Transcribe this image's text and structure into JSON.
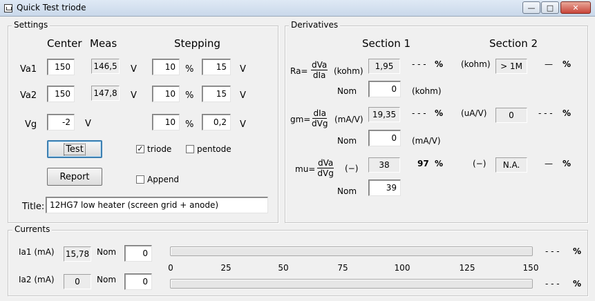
{
  "window": {
    "title": "Quick Test triode",
    "minimize": "—",
    "maximize": "□",
    "close": "✕"
  },
  "settings": {
    "group_label": "Settings",
    "col_center": "Center",
    "col_meas": "Meas",
    "col_stepping": "Stepping",
    "rows": [
      {
        "label": "Va1",
        "center": "150",
        "meas": "146,5",
        "unit1": "V",
        "step1": "10",
        "pct": "%",
        "step2": "15",
        "unit2": "V"
      },
      {
        "label": "Va2",
        "center": "150",
        "meas": "147,8",
        "unit1": "V",
        "step1": "10",
        "pct": "%",
        "step2": "15",
        "unit2": "V"
      },
      {
        "label": "Vg",
        "center": "-2",
        "unit1": "V",
        "step1": "10",
        "pct": "%",
        "step2": "0,2",
        "unit2": "V"
      }
    ],
    "test_button": "Test",
    "report_button": "Report",
    "triode_label": "triode",
    "triode_checked": true,
    "pentode_label": "pentode",
    "pentode_checked": false,
    "append_label": "Append",
    "append_checked": false,
    "title_label": "Title:",
    "title_value": "12HG7 low heater (screen grid + anode)"
  },
  "derivatives": {
    "group_label": "Derivatives",
    "section1": "Section 1",
    "section2": "Section 2",
    "ra": {
      "label": "Ra=",
      "num": "dVa",
      "den": "dIa",
      "unit1": "(kohm)",
      "value1": "1,95",
      "dev1": "- - -",
      "pct1": "%",
      "unit2": "(kohm)",
      "value2": "> 1M",
      "dev2": "—",
      "pct2": "%",
      "nom_label": "Nom",
      "nom_value": "0",
      "nom_unit": "(kohm)"
    },
    "gm": {
      "label": "gm=",
      "num": "dIa",
      "den": "dVg",
      "unit1": "(mA/V)",
      "value1": "19,35",
      "dev1": "- - -",
      "pct1": "%",
      "unit2": "(uA/V)",
      "value2": "0",
      "dev2": "- - -",
      "pct2": "%",
      "nom_label": "Nom",
      "nom_value": "0",
      "nom_unit": "(mA/V)"
    },
    "mu": {
      "label": "mu=",
      "num": "dVa",
      "den": "dVg",
      "unit1": "(−)",
      "value1": "38",
      "dev1": "97",
      "pct1": "%",
      "unit2": "(−)",
      "value2": "N.A.",
      "dev2": "—",
      "pct2": "%",
      "nom_label": "Nom",
      "nom_value": "39"
    }
  },
  "currents": {
    "group_label": "Currents",
    "ia1_label": "Ia1 (mA)",
    "ia1_value": "15,78",
    "ia1_nom_label": "Nom",
    "ia1_nom": "0",
    "ia1_dev": "- - -",
    "ia1_pct": "%",
    "ia2_label": "Ia2 (mA)",
    "ia2_value": "0",
    "ia2_nom_label": "Nom",
    "ia2_nom": "0",
    "ia2_dev": "- - -",
    "ia2_pct": "%",
    "scale_ticks": [
      "0",
      "25",
      "50",
      "75",
      "100",
      "125",
      "150"
    ],
    "bar1_level": 0,
    "bar2_level": 0
  }
}
